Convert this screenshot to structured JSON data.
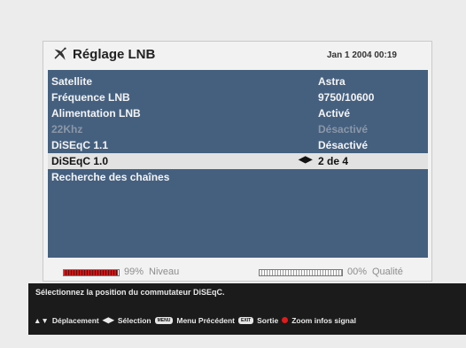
{
  "header": {
    "title": "Réglage LNB",
    "date": "Jan 1 2004 00:19",
    "icon": "satellite-dish-icon"
  },
  "menu": {
    "rows": [
      {
        "label": "Satellite",
        "value": "Astra",
        "state": "normal"
      },
      {
        "label": "Fréquence LNB",
        "value": "9750/10600",
        "state": "normal"
      },
      {
        "label": "Alimentation LNB",
        "value": "Activé",
        "state": "normal"
      },
      {
        "label": "22Khz",
        "value": "Désactivé",
        "state": "disabled"
      },
      {
        "label": "DiSEqC 1.1",
        "value": "Désactivé",
        "state": "normal"
      },
      {
        "label": "DiSEqC 1.0",
        "value": "2 de 4",
        "state": "selected"
      },
      {
        "label": "Recherche des chaînes",
        "value": "",
        "state": "normal"
      }
    ],
    "selected_arrow": "◀▶"
  },
  "meters": {
    "level": {
      "percent_text": "99%",
      "label": "Niveau",
      "fraction": 0.99
    },
    "quality": {
      "percent_text": "00%",
      "label": "Qualité",
      "fraction": 0.0
    }
  },
  "footer": {
    "hint": "Sélectionnez la position du commutateur DiSEqC.",
    "nav": {
      "move_icon": "▲▼",
      "move_label": "Déplacement",
      "select_icon": "◀▶",
      "select_label": "Sélection",
      "menu_key": "MENU",
      "menu_label": "Menu Précédent",
      "exit_key": "EXIT",
      "exit_label": "Sortie",
      "zoom_label": "Zoom infos signal"
    }
  },
  "colors": {
    "list_bg": "#45607f",
    "selected_bg": "#e2e2e2",
    "meter_fill": "#c81a1a",
    "footer_bg": "#1b1b1b"
  }
}
